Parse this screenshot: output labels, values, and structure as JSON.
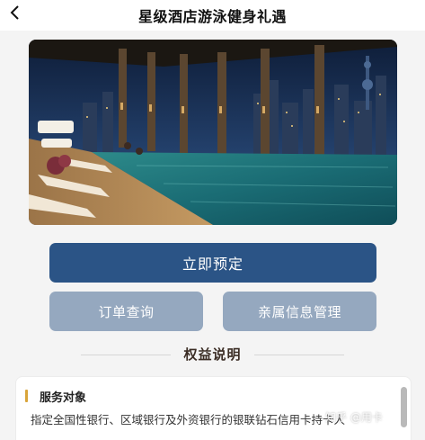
{
  "header": {
    "title": "星级酒店游泳健身礼遇",
    "back_icon": "chevron-left-icon"
  },
  "hero": {
    "alt": "酒店室内泳池"
  },
  "actions": {
    "book_label": "立即预定",
    "orders_label": "订单查询",
    "family_label": "亲属信息管理",
    "primary_color": "#2b5486",
    "secondary_color": "#95a8bf"
  },
  "section": {
    "title": "权益说明"
  },
  "card": {
    "title": "服务对象",
    "body": "指定全国性银行、区域银行及外资银行的银联钻石信用卡持卡人",
    "accent_color": "#d9a53a"
  },
  "watermark": {
    "text": "知乎 @用卡"
  }
}
